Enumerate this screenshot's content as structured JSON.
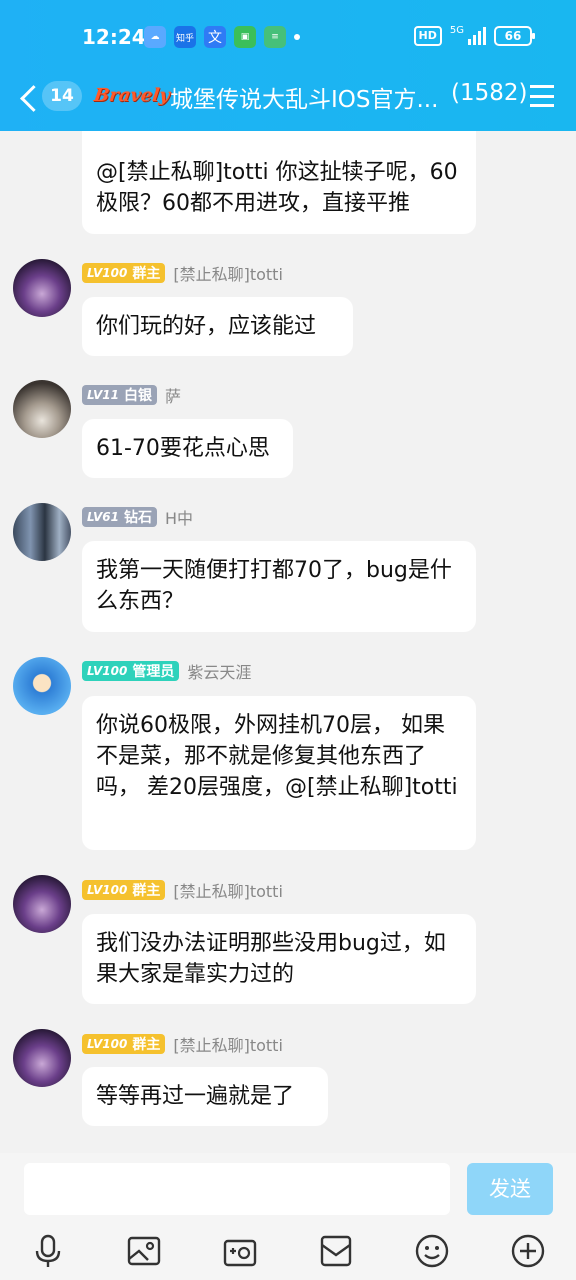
{
  "status": {
    "time": "12:24",
    "apps": [
      "☁",
      "知乎",
      "文",
      "▣",
      "≡"
    ],
    "hd": "HD",
    "network": "5G",
    "battery": "66"
  },
  "header": {
    "back_badge": "14",
    "logo_text": "Bravely",
    "title": "城堡传说大乱斗IOS官方...",
    "member_count": "(1582)"
  },
  "messages": [
    {
      "partial": true,
      "text": "@[禁止私聊]totti 你这扯犊子呢，60极限？60都不用进攻，直接平推"
    },
    {
      "level": "LV100",
      "role": "群主",
      "level_color": "#f5c12e",
      "nick": "[禁止私聊]totti",
      "text": "你们玩的好，应该能过"
    },
    {
      "level": "LV11",
      "role": "白银",
      "level_color": "#9aa3b6",
      "nick": "萨",
      "text": "61-70要花点心思"
    },
    {
      "level": "LV61",
      "role": "钻石",
      "level_color": "#9aa3b6",
      "nick": "H中",
      "text": "我第一天随便打打都70了，bug是什么东西？"
    },
    {
      "level": "LV100",
      "role": "管理员",
      "level_color": "#2ed2bb",
      "nick": "紫云天涯",
      "text": "你说60极限，外网挂机70层， 如果不是菜，那不就是修复其他东西了吗， 差20层强度，@[禁止私聊]totti"
    },
    {
      "level": "LV100",
      "role": "群主",
      "level_color": "#f5c12e",
      "nick": "[禁止私聊]totti",
      "text": "我们没办法证明那些没用bug过，如果大家是靠实力过的"
    },
    {
      "level": "LV100",
      "role": "群主",
      "level_color": "#f5c12e",
      "nick": "[禁止私聊]totti",
      "text": "等等再过一遍就是了"
    }
  ],
  "input": {
    "value": "",
    "send_label": "发送"
  },
  "toolbar": [
    "microphone-icon",
    "image-icon",
    "camera-icon",
    "envelope-icon",
    "emoji-icon",
    "plus-icon"
  ]
}
